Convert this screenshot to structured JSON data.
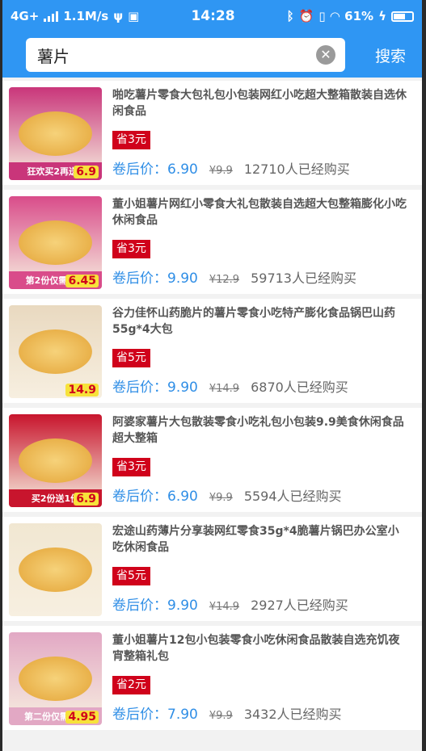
{
  "status_bar": {
    "network": "4G+",
    "speed": "1.1M/s",
    "time": "14:28",
    "battery": "61%"
  },
  "search": {
    "query": "薯片",
    "button_label": "搜索"
  },
  "labels": {
    "after_coupon": "卷后价："
  },
  "products": [
    {
      "title": "啪吃薯片零食大包礼包小包装网红小吃超大整箱散装自选休闲食品",
      "coupon": "省3元",
      "after_price": "6.90",
      "original_price": "¥9.9",
      "sold": "12710人已经购买",
      "thumb_banner": "狂欢买2再送1",
      "thumb_price": "6.9",
      "thumb_color": "#c9357a"
    },
    {
      "title": "董小姐薯片网红小零食大礼包散装自选超大包整箱膨化小吃休闲食品",
      "coupon": "省3元",
      "after_price": "9.90",
      "original_price": "¥12.9",
      "sold": "59713人已经购买",
      "thumb_banner": "第2份仅需半价",
      "thumb_price": "6.45",
      "thumb_color": "#d94c8a"
    },
    {
      "title": "谷力佳怀山药脆片的薯片零食小吃特产膨化食品锅巴山药55g*4大包",
      "coupon": "省5元",
      "after_price": "9.90",
      "original_price": "¥14.9",
      "sold": "6870人已经购买",
      "thumb_banner": "",
      "thumb_price": "14.9",
      "thumb_color": "#e9d9c0"
    },
    {
      "title": "阿婆家薯片大包散装零食小吃礼包小包装9.9美食休闲食品超大整箱",
      "coupon": "省3元",
      "after_price": "6.90",
      "original_price": "¥9.9",
      "sold": "5594人已经购买",
      "thumb_banner": "买2份送1份",
      "thumb_price": "6.9",
      "thumb_color": "#c8152d"
    },
    {
      "title": "宏途山药薄片分享装网红零食35g*4脆薯片锅巴办公室小吃休闲食品",
      "coupon": "省5元",
      "after_price": "9.90",
      "original_price": "¥14.9",
      "sold": "2927人已经购买",
      "thumb_banner": "",
      "thumb_price": "",
      "thumb_color": "#f1e7d2"
    },
    {
      "title": "董小姐薯片12包小包装零食小吃休闲食品散装自选充饥夜宵整箱礼包",
      "coupon": "省2元",
      "after_price": "7.90",
      "original_price": "¥9.9",
      "sold": "3432人已经购买",
      "thumb_banner": "第二份仅需半价",
      "thumb_price": "4.95",
      "thumb_color": "#e2a8c4"
    }
  ]
}
